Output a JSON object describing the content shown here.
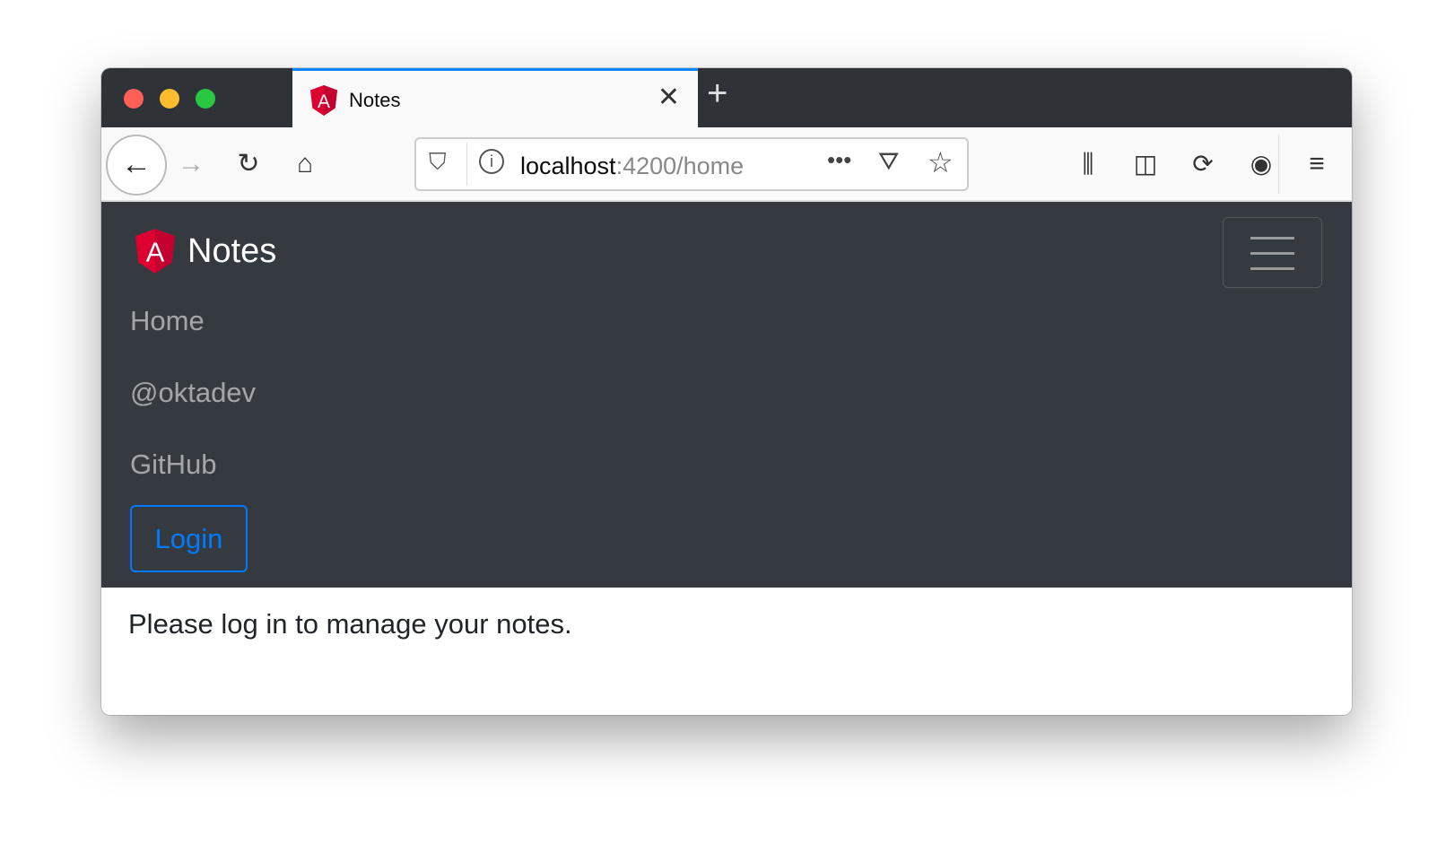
{
  "browser": {
    "tab": {
      "title": "Notes",
      "favicon": "angular-logo-icon"
    },
    "url": {
      "host": "localhost",
      "rest": ":4200/home"
    },
    "icons": [
      "back-arrow-icon",
      "forward-arrow-icon",
      "reload-icon",
      "home-icon",
      "shield-icon",
      "info-icon",
      "more-icon",
      "pocket-icon",
      "star-icon",
      "library-icon",
      "sidebar-icon",
      "sync-icon",
      "account-icon",
      "menu-icon"
    ]
  },
  "navbar": {
    "brand": "Notes",
    "links": [
      {
        "label": "Home"
      },
      {
        "label": "@oktadev"
      },
      {
        "label": "GitHub"
      }
    ],
    "login_label": "Login"
  },
  "main": {
    "message": "Please log in to manage your notes."
  },
  "colors": {
    "navbar": "#343a40",
    "accent": "#007bff",
    "angular": "#dd0031"
  }
}
